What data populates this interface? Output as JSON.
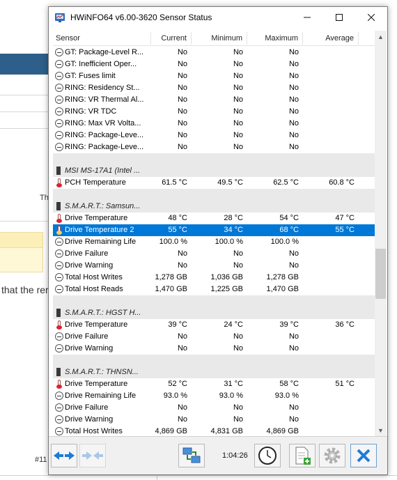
{
  "window": {
    "title": "HWiNFO64 v6.00-3620 Sensor Status"
  },
  "background": {
    "text1": "Th",
    "text2": "that the rer",
    "text3": "#11"
  },
  "columns": {
    "sensor": "Sensor",
    "current": "Current",
    "minimum": "Minimum",
    "maximum": "Maximum",
    "average": "Average"
  },
  "rows": [
    {
      "type": "item",
      "icon": "minus-icon",
      "name": "GT: Package-Level R...",
      "cur": "No",
      "min": "No",
      "max": "No",
      "avg": ""
    },
    {
      "type": "item",
      "icon": "minus-icon",
      "name": "GT: Inefficient Oper...",
      "cur": "No",
      "min": "No",
      "max": "No",
      "avg": ""
    },
    {
      "type": "item",
      "icon": "minus-icon",
      "name": "GT: Fuses limit",
      "cur": "No",
      "min": "No",
      "max": "No",
      "avg": ""
    },
    {
      "type": "item",
      "icon": "minus-icon",
      "name": "RING: Residency St...",
      "cur": "No",
      "min": "No",
      "max": "No",
      "avg": ""
    },
    {
      "type": "item",
      "icon": "minus-icon",
      "name": "RING: VR Thermal Al...",
      "cur": "No",
      "min": "No",
      "max": "No",
      "avg": ""
    },
    {
      "type": "item",
      "icon": "minus-icon",
      "name": "RING: VR TDC",
      "cur": "No",
      "min": "No",
      "max": "No",
      "avg": ""
    },
    {
      "type": "item",
      "icon": "minus-icon",
      "name": "RING: Max VR Volta...",
      "cur": "No",
      "min": "No",
      "max": "No",
      "avg": ""
    },
    {
      "type": "item",
      "icon": "minus-icon",
      "name": "RING: Package-Leve...",
      "cur": "No",
      "min": "No",
      "max": "No",
      "avg": ""
    },
    {
      "type": "item",
      "icon": "minus-icon",
      "name": "RING: Package-Leve...",
      "cur": "No",
      "min": "No",
      "max": "No",
      "avg": ""
    },
    {
      "type": "spacer"
    },
    {
      "type": "group",
      "icon": "chip-icon",
      "name": "MSI MS-17A1 (Intel ..."
    },
    {
      "type": "item",
      "icon": "thermo-icon",
      "name": "PCH Temperature",
      "cur": "61.5 °C",
      "min": "49.5 °C",
      "max": "62.5 °C",
      "avg": "60.8 °C"
    },
    {
      "type": "spacer"
    },
    {
      "type": "group",
      "icon": "chip-icon",
      "name": "S.M.A.R.T.: Samsun..."
    },
    {
      "type": "item",
      "icon": "thermo-icon",
      "name": "Drive Temperature",
      "cur": "48 °C",
      "min": "28 °C",
      "max": "54 °C",
      "avg": "47 °C"
    },
    {
      "type": "item",
      "icon": "thermo-icon",
      "name": "Drive Temperature 2",
      "cur": "55 °C",
      "min": "34 °C",
      "max": "68 °C",
      "avg": "55 °C",
      "selected": true
    },
    {
      "type": "item",
      "icon": "minus-icon",
      "name": "Drive Remaining Life",
      "cur": "100.0 %",
      "min": "100.0 %",
      "max": "100.0 %",
      "avg": ""
    },
    {
      "type": "item",
      "icon": "minus-icon",
      "name": "Drive Failure",
      "cur": "No",
      "min": "No",
      "max": "No",
      "avg": ""
    },
    {
      "type": "item",
      "icon": "minus-icon",
      "name": "Drive Warning",
      "cur": "No",
      "min": "No",
      "max": "No",
      "avg": ""
    },
    {
      "type": "item",
      "icon": "minus-icon",
      "name": "Total Host Writes",
      "cur": "1,278 GB",
      "min": "1,036 GB",
      "max": "1,278 GB",
      "avg": ""
    },
    {
      "type": "item",
      "icon": "minus-icon",
      "name": "Total Host Reads",
      "cur": "1,470 GB",
      "min": "1,225 GB",
      "max": "1,470 GB",
      "avg": ""
    },
    {
      "type": "spacer"
    },
    {
      "type": "group",
      "icon": "chip-icon",
      "name": "S.M.A.R.T.: HGST H..."
    },
    {
      "type": "item",
      "icon": "thermo-icon",
      "name": "Drive Temperature",
      "cur": "39 °C",
      "min": "24 °C",
      "max": "39 °C",
      "avg": "36 °C"
    },
    {
      "type": "item",
      "icon": "minus-icon",
      "name": "Drive Failure",
      "cur": "No",
      "min": "No",
      "max": "No",
      "avg": ""
    },
    {
      "type": "item",
      "icon": "minus-icon",
      "name": "Drive Warning",
      "cur": "No",
      "min": "No",
      "max": "No",
      "avg": ""
    },
    {
      "type": "spacer"
    },
    {
      "type": "group",
      "icon": "chip-icon",
      "name": "S.M.A.R.T.: THNSN..."
    },
    {
      "type": "item",
      "icon": "thermo-icon",
      "name": "Drive Temperature",
      "cur": "52 °C",
      "min": "31 °C",
      "max": "58 °C",
      "avg": "51 °C"
    },
    {
      "type": "item",
      "icon": "minus-icon",
      "name": "Drive Remaining Life",
      "cur": "93.0 %",
      "min": "93.0 %",
      "max": "93.0 %",
      "avg": ""
    },
    {
      "type": "item",
      "icon": "minus-icon",
      "name": "Drive Failure",
      "cur": "No",
      "min": "No",
      "max": "No",
      "avg": ""
    },
    {
      "type": "item",
      "icon": "minus-icon",
      "name": "Drive Warning",
      "cur": "No",
      "min": "No",
      "max": "No",
      "avg": ""
    },
    {
      "type": "item",
      "icon": "minus-icon",
      "name": "Total Host Writes",
      "cur": "4,869 GB",
      "min": "4,831 GB",
      "max": "4,869 GB",
      "avg": ""
    }
  ],
  "toolbar": {
    "timer": "1:04:26"
  },
  "colors": {
    "selection": "#0078d7",
    "group_bg": "#e9e9e9",
    "accent_blue": "#1e7ad6"
  }
}
